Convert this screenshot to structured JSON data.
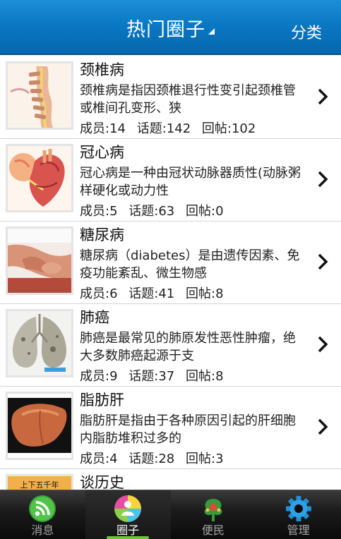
{
  "header": {
    "title": "热门圈子",
    "category_label": "分类",
    "accent": "#0a77c2"
  },
  "stats_labels": {
    "members": "成员:",
    "topics": "话题:",
    "replies": "回帖:"
  },
  "circles": [
    {
      "title": "颈椎病",
      "desc": "颈椎病是指因颈椎退行性变引起颈椎管或椎间孔变形、狭",
      "members": "14",
      "topics": "142",
      "replies": "102",
      "image": "cervical-spine-illustration"
    },
    {
      "title": "冠心病",
      "desc": "冠心病是一种由冠状动脉器质性(动脉粥样硬化或动力性",
      "members": "5",
      "topics": "63",
      "replies": "0",
      "image": "heart-illustration"
    },
    {
      "title": "糖尿病",
      "desc": "糖尿病（diabetes）是由遗传因素、免疫功能紊乱、微生物感",
      "members": "6",
      "topics": "41",
      "replies": "8",
      "image": "hands-massage-photo"
    },
    {
      "title": "肺癌",
      "desc": "肺癌是最常见的肺原发性恶性肿瘤，绝大多数肺癌起源于支",
      "members": "9",
      "topics": "37",
      "replies": "8",
      "image": "lungs-photo"
    },
    {
      "title": "脂肪肝",
      "desc": "脂肪肝是指由于各种原因引起的肝细胞内脂肪堆积过多的",
      "members": "4",
      "topics": "28",
      "replies": "3",
      "image": "liver-photo"
    },
    {
      "title": "谈历史",
      "desc": "",
      "members": "",
      "topics": "",
      "replies": "",
      "image": "book-cover",
      "image_text": "上下五千年"
    }
  ],
  "nav": [
    {
      "label": "消息",
      "icon": "rss-feed-icon",
      "active": false
    },
    {
      "label": "圈子",
      "icon": "people-circle-icon",
      "active": true
    },
    {
      "label": "便民",
      "icon": "tree-people-icon",
      "active": false
    },
    {
      "label": "管理",
      "icon": "gear-icon",
      "active": false
    }
  ]
}
